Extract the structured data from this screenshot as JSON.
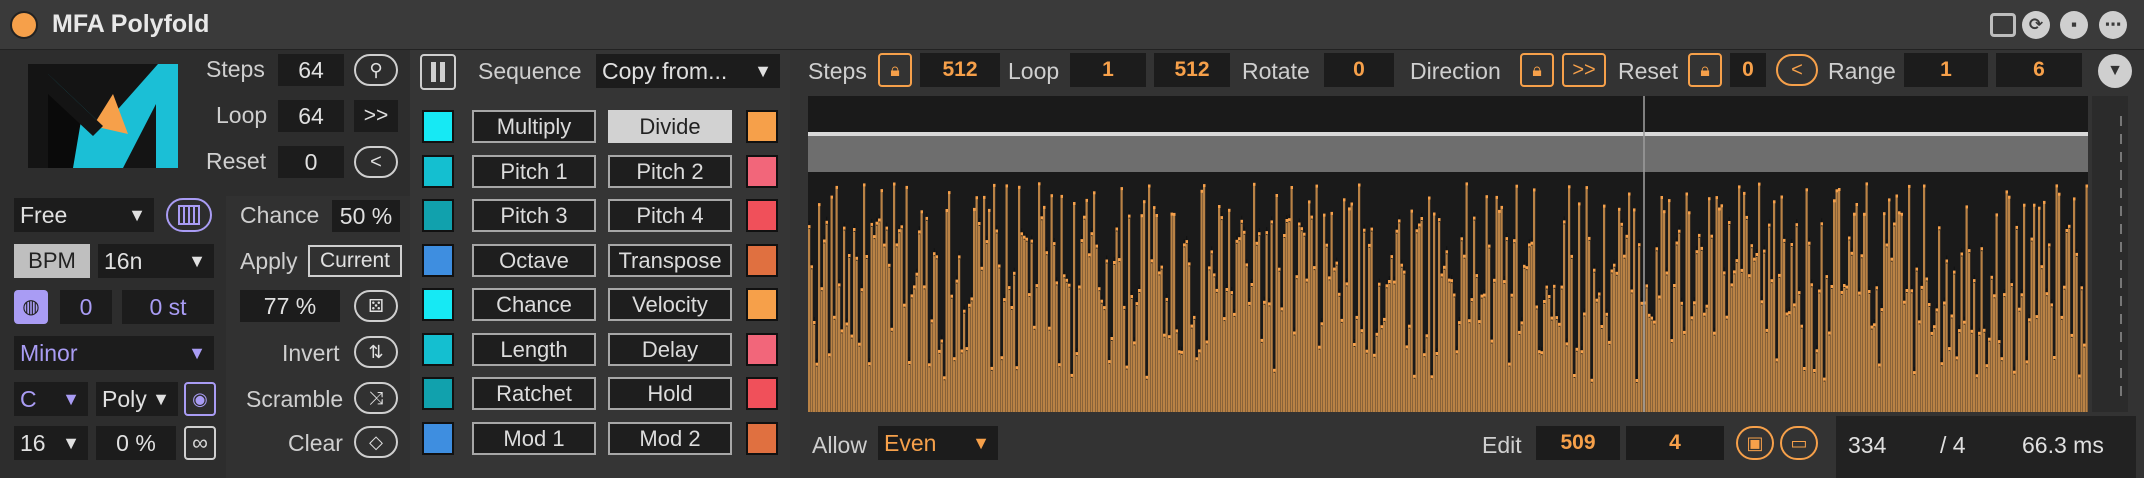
{
  "window": {
    "title": "MFA Polyfold"
  },
  "titlebar_icons": [
    "device-icon",
    "refresh-icon",
    "save-icon",
    "more-icon"
  ],
  "left": {
    "steps_label": "Steps",
    "steps_value": "64",
    "loop_label": "Loop",
    "loop_value": "64",
    "loop_dir": ">>",
    "reset_label": "Reset",
    "reset_value": "0",
    "reset_dir": "<",
    "mode_value": "Free",
    "bpm_label": "BPM",
    "rate_value": "16n",
    "transpose_value": "0",
    "semitone_value": "0 st",
    "scale_value": "Minor",
    "root_value": "C",
    "voice_value": "Poly",
    "len_value": "16",
    "swing_value": "0 %",
    "chance_label": "Chance",
    "chance_value": "50 %",
    "apply_label": "Apply",
    "apply_value": "Current",
    "random_value": "77 %",
    "invert_label": "Invert",
    "scramble_label": "Scramble",
    "clear_label": "Clear"
  },
  "sequence": {
    "label": "Sequence",
    "copy_value": "Copy from...",
    "left_buttons": [
      "Multiply",
      "Pitch 1",
      "Pitch 3",
      "Octave",
      "Chance",
      "Length",
      "Ratchet",
      "Mod 1"
    ],
    "right_buttons": [
      "Divide",
      "Pitch 2",
      "Pitch 4",
      "Transpose",
      "Velocity",
      "Delay",
      "Hold",
      "Mod 2"
    ],
    "selected": "Divide",
    "left_colors": [
      "#16e9f4",
      "#14bfd0",
      "#11a1ad",
      "#3e8ee0",
      "#16e9f4",
      "#14bfd0",
      "#11a1ad",
      "#3e8ee0"
    ],
    "right_colors": [
      "#f6a04a",
      "#f2667a",
      "#f0505a",
      "#e07040",
      "#f6a04a",
      "#f2667a",
      "#f0505a",
      "#e07040"
    ]
  },
  "top": {
    "steps_label": "Steps",
    "steps_value": "512",
    "loop_label": "Loop",
    "loop_start": "1",
    "loop_end": "512",
    "rotate_label": "Rotate",
    "rotate_value": "0",
    "direction_label": "Direction",
    "direction_value": ">>",
    "reset_label": "Reset",
    "reset_value": "0",
    "reset_dir": "<",
    "range_label": "Range",
    "range_min": "1",
    "range_max": "6"
  },
  "bottom": {
    "allow_label": "Allow",
    "allow_value": "Even",
    "edit_label": "Edit",
    "edit_step": "509",
    "edit_value": "4",
    "pos_step": "334",
    "pos_div": "/ 4",
    "pos_time": "66.3 ms"
  },
  "colors": {
    "accent": "#f6a04a",
    "bar_fill": "#b98245",
    "bar_tip": "#f6a04a"
  },
  "chart_data": {
    "type": "bar",
    "steps": 512,
    "playhead_step": 334,
    "range": [
      1,
      6
    ]
  }
}
